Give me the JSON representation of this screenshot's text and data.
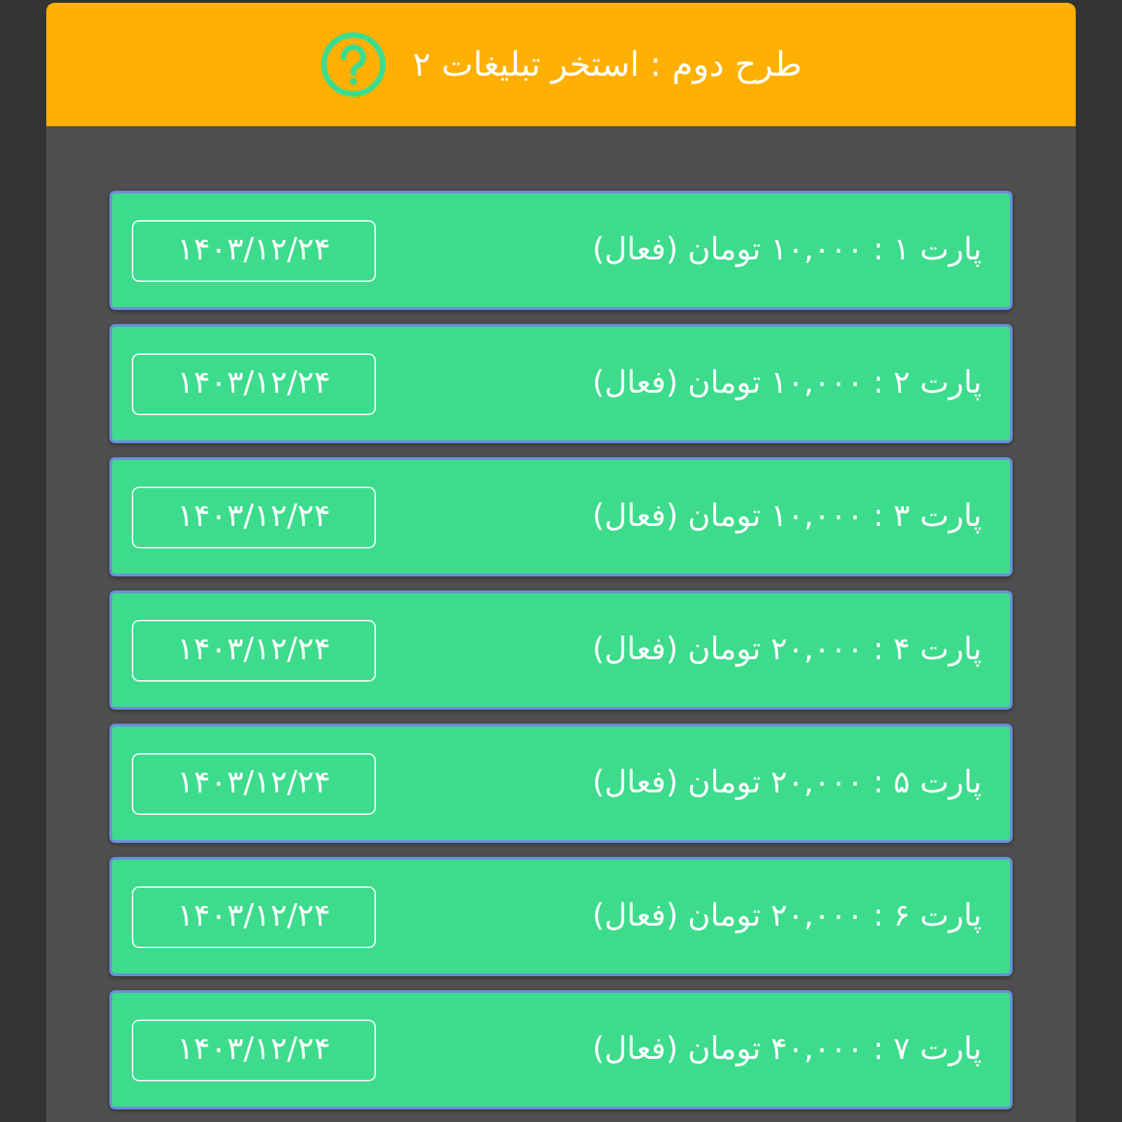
{
  "header": {
    "title": "طرح دوم : استخر تبلیغات ۲"
  },
  "parts": [
    {
      "label": "پارت ۱ : ۱۰,۰۰۰ تومان (فعال)",
      "date": "۱۴۰۳/۱۲/۲۴"
    },
    {
      "label": "پارت ۲ : ۱۰,۰۰۰ تومان (فعال)",
      "date": "۱۴۰۳/۱۲/۲۴"
    },
    {
      "label": "پارت ۳ : ۱۰,۰۰۰ تومان (فعال)",
      "date": "۱۴۰۳/۱۲/۲۴"
    },
    {
      "label": "پارت ۴ : ۲۰,۰۰۰ تومان (فعال)",
      "date": "۱۴۰۳/۱۲/۲۴"
    },
    {
      "label": "پارت ۵ : ۲۰,۰۰۰ تومان (فعال)",
      "date": "۱۴۰۳/۱۲/۲۴"
    },
    {
      "label": "پارت ۶ : ۲۰,۰۰۰ تومان (فعال)",
      "date": "۱۴۰۳/۱۲/۲۴"
    },
    {
      "label": "پارت ۷ : ۴۰,۰۰۰ تومان (فعال)",
      "date": "۱۴۰۳/۱۲/۲۴"
    }
  ]
}
